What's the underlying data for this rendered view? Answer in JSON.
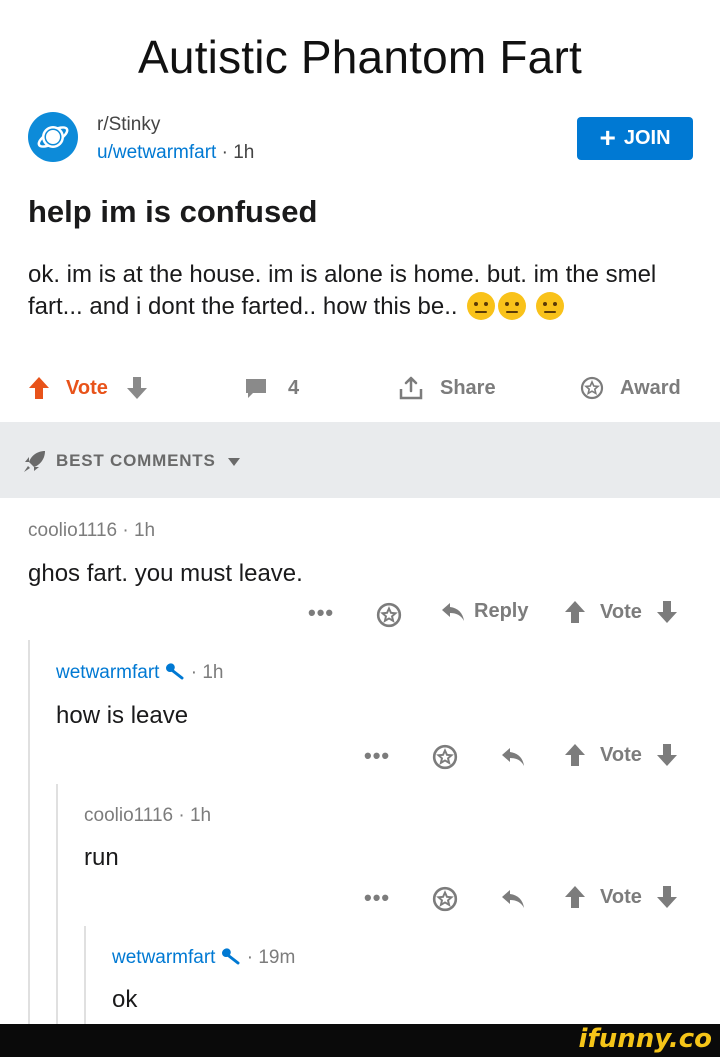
{
  "meme": {
    "title": "Autistic Phantom Fart"
  },
  "post": {
    "subreddit": "r/Stinky",
    "author": "u/wetwarmfart",
    "time": "1h",
    "join_label": "JOIN",
    "title": "help im is confused",
    "body": "ok. im is at the house. im is alone is home. but. im the smel fart... and i dont the farted.. how this be..",
    "actions": {
      "vote_label": "Vote",
      "comments_count": "4",
      "share_label": "Share",
      "award_label": "Award"
    }
  },
  "sort": {
    "label": "BEST COMMENTS"
  },
  "comments": [
    {
      "author": "coolio1116",
      "time": "1h",
      "text": "ghos fart. you must leave.",
      "reply_label": "Reply",
      "vote_label": "Vote"
    },
    {
      "author": "wetwarmfart",
      "time": "1h",
      "text": "how is leave",
      "vote_label": "Vote"
    },
    {
      "author": "coolio1116",
      "time": "1h",
      "text": "run",
      "vote_label": "Vote"
    },
    {
      "author": "wetwarmfart",
      "time": "19m",
      "text": "ok"
    }
  ],
  "meta_sep": "·",
  "more_dots": "•••",
  "watermark": "ifunny.co",
  "colors": {
    "accent": "#0079d3",
    "upvote": "#e8531a",
    "muted": "#7c7c7c",
    "sort_bar": "#e9ebed"
  }
}
